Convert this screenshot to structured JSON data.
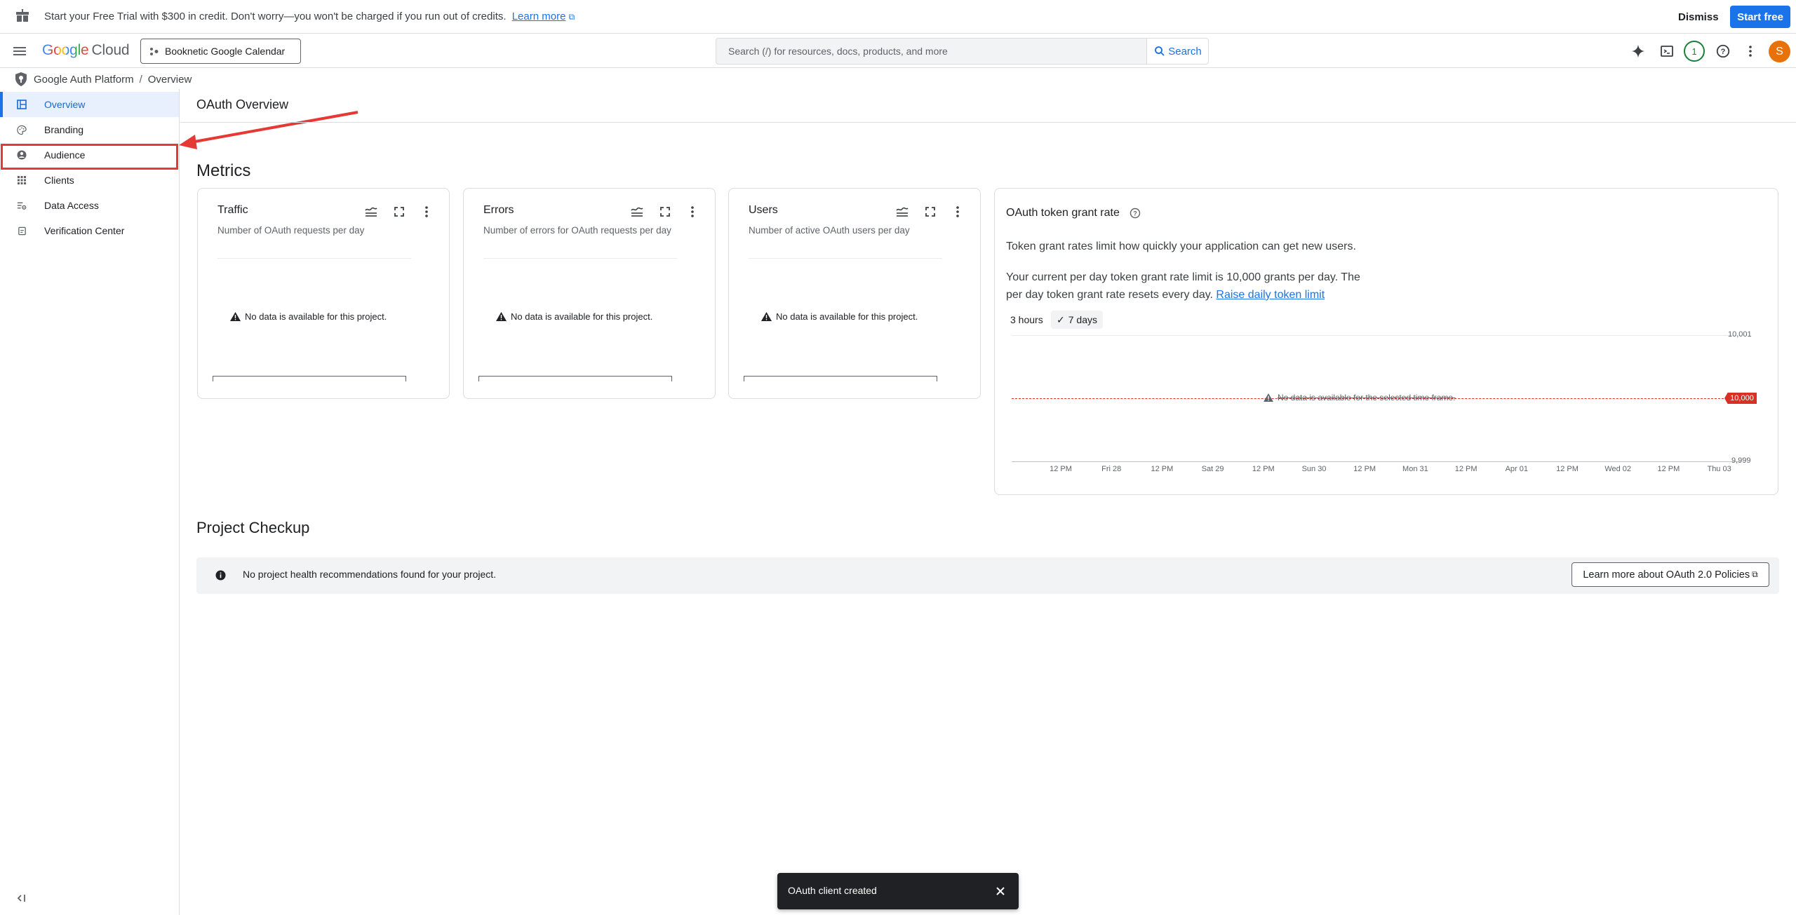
{
  "banner": {
    "text": "Start your Free Trial with $300 in credit. Don't worry—you won't be charged if you run out of credits.",
    "learn_more": "Learn more",
    "dismiss": "Dismiss",
    "start_free": "Start free"
  },
  "header": {
    "logo_google": "Google",
    "logo_cloud": "Cloud",
    "project": "Booknetic Google Calendar",
    "search_placeholder": "Search (/) for resources, docs, products, and more",
    "search_button": "Search",
    "notification_count": "1",
    "avatar_initial": "S"
  },
  "breadcrumb": {
    "root": "Google Auth Platform",
    "separator": "/",
    "current": "Overview"
  },
  "sidebar": {
    "items": [
      {
        "label": "Overview",
        "icon": "dashboard-icon",
        "active": true
      },
      {
        "label": "Branding",
        "icon": "palette-icon"
      },
      {
        "label": "Audience",
        "icon": "person-circle-icon"
      },
      {
        "label": "Clients",
        "icon": "apps-grid-icon"
      },
      {
        "label": "Data Access",
        "icon": "data-access-icon"
      },
      {
        "label": "Verification Center",
        "icon": "verification-icon"
      }
    ]
  },
  "main": {
    "title": "OAuth Overview",
    "metrics_heading": "Metrics",
    "cards": [
      {
        "title": "Traffic",
        "subtitle": "Number of OAuth requests per day",
        "nodata": "No data is available for this project."
      },
      {
        "title": "Errors",
        "subtitle": "Number of errors for OAuth requests per day",
        "nodata": "No data is available for this project."
      },
      {
        "title": "Users",
        "subtitle": "Number of active OAuth users per day",
        "nodata": "No data is available for this project."
      }
    ],
    "token": {
      "title": "OAuth token grant rate",
      "desc1": "Token grant rates limit how quickly your application can get new users.",
      "desc2": "Your current per day token grant rate limit is 10,000 grants per day. The per day token grant rate resets every day.",
      "raise_link": "Raise daily token limit",
      "range_3h": "3 hours",
      "range_7d": "7 days",
      "ymax": "10,001",
      "ymin": "9,999",
      "limit": "10,000",
      "nodata": "No data is available for the selected time frame.",
      "xticks": [
        "12 PM",
        "Fri 28",
        "12 PM",
        "Sat 29",
        "12 PM",
        "Sun 30",
        "12 PM",
        "Mon 31",
        "12 PM",
        "Apr 01",
        "12 PM",
        "Wed 02",
        "12 PM",
        "Thu 03"
      ]
    },
    "checkup_heading": "Project Checkup",
    "checkup_text": "No project health recommendations found for your project.",
    "checkup_button": "Learn more about OAuth 2.0 Policies"
  },
  "snackbar": {
    "text": "OAuth client created"
  },
  "colors": {
    "accent": "#1a73e8",
    "highlight": "#e53935"
  }
}
